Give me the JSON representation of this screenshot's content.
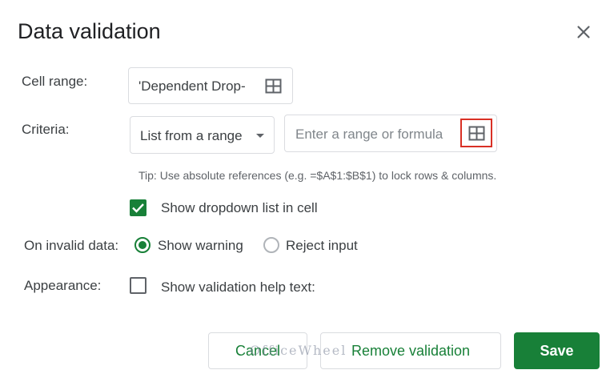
{
  "dialog": {
    "title": "Data validation",
    "close_icon": "close-icon"
  },
  "cell_range": {
    "label": "Cell range:",
    "value": "'Dependent Drop-",
    "icon": "grid-select-icon"
  },
  "criteria": {
    "label": "Criteria:",
    "type_value": "List from a range",
    "dropdown_icon": "caret-down-icon",
    "range_placeholder": "Enter a range or formula",
    "range_icon": "grid-select-icon",
    "highlight_color": "#d93025",
    "tip": "Tip: Use absolute references (e.g. =$A$1:$B$1) to lock rows & columns."
  },
  "show_dropdown": {
    "label": "Show dropdown list in cell",
    "checked": true
  },
  "invalid_data": {
    "label": "On invalid data:",
    "options": [
      {
        "label": "Show warning",
        "selected": true
      },
      {
        "label": "Reject input",
        "selected": false
      }
    ]
  },
  "appearance": {
    "label": "Appearance:",
    "help_text_label": "Show validation help text:",
    "checked": false
  },
  "buttons": {
    "cancel": "Cancel",
    "remove": "Remove validation",
    "save": "Save"
  },
  "watermark": "OfficeWheel",
  "colors": {
    "accent": "#188038",
    "text": "#202124",
    "border": "#dadce0"
  }
}
